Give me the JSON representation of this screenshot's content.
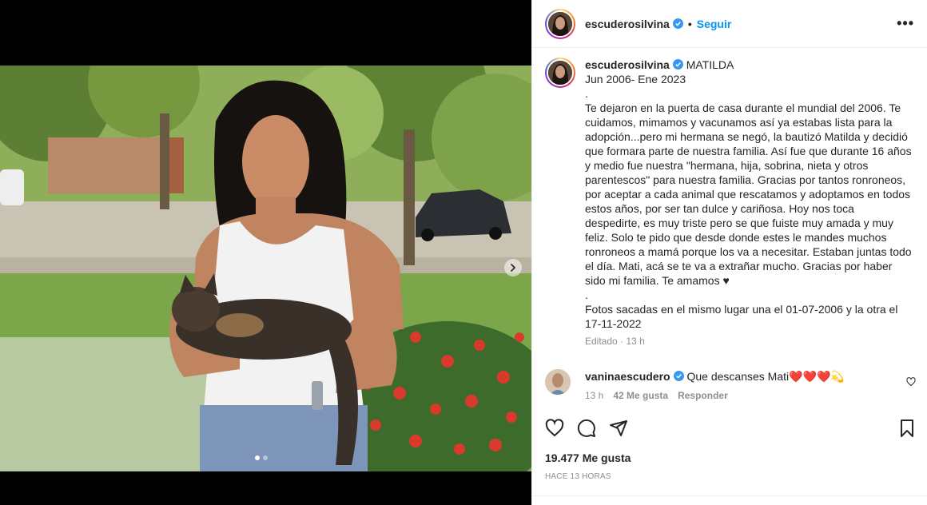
{
  "post": {
    "username": "escuderosilvina",
    "follow_label": "Seguir",
    "more_label": "•••",
    "dot": "•"
  },
  "caption": {
    "username": "escuderosilvina",
    "text": "MATILDA\nJun 2006- Ene 2023\n.\nTe dejaron en la puerta de casa durante el mundial del 2006. Te cuidamos, mimamos y vacunamos así ya estabas lista para la adopción...pero mi hermana se negó, la bautizó Matilda y decidió que formara parte de nuestra familia. Así fue que durante 16 años y medio fue nuestra \"hermana, hija, sobrina, nieta y otros parentescos\" para nuestra familia. Gracias por tantos ronroneos, por aceptar a cada animal que rescatamos y adoptamos en todos estos años, por ser tan dulce y cariñosa. Hoy nos toca despedirte, es muy triste pero se que fuiste muy amada y muy feliz. Solo te pido que desde donde estes le mandes muchos ronroneos a mamá porque los va a necesitar. Estaban juntas todo el día. Mati, acá se te va a extrañar mucho. Gracias por haber sido mi familia. Te amamos ♥\n.\nFotos sacadas en el mismo lugar una el 01-07-2006 y la otra el 17-11-2022",
    "edited_label": "Editado",
    "time": "13 h"
  },
  "comment": {
    "username": "vaninaescudero",
    "text": "Que descanses Mati❤️❤️❤️💫",
    "time": "13 h",
    "likes": "42 Me gusta",
    "reply_label": "Responder"
  },
  "stats": {
    "likes": "19.477 Me gusta",
    "posted_ago": "Hace 13 horas"
  },
  "carousel": {
    "count": 2,
    "active_index": 0
  },
  "icons": {
    "verified": "verified-badge-icon",
    "like": "heart-icon",
    "comment": "comment-icon",
    "share": "share-icon",
    "save": "bookmark-icon",
    "next": "chevron-right-icon"
  },
  "colors": {
    "accent": "#0095f6",
    "text": "#262626",
    "muted": "#8e8e8e",
    "media_bg": "#000000"
  }
}
